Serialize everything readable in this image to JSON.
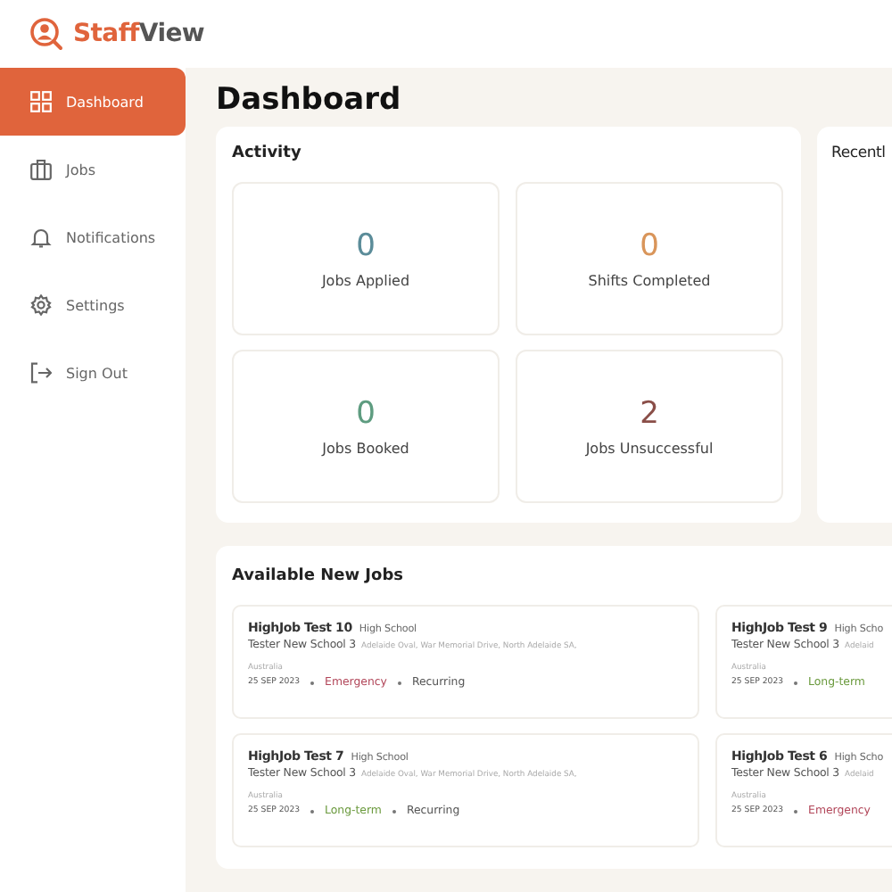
{
  "brand": {
    "name_part1": "Staff",
    "name_part2": "View"
  },
  "sidebar": {
    "items": [
      {
        "label": "Dashboard",
        "selected": true
      },
      {
        "label": "Jobs",
        "selected": false
      },
      {
        "label": "Notifications",
        "selected": false
      },
      {
        "label": "Settings",
        "selected": false
      },
      {
        "label": "Sign Out",
        "selected": false
      }
    ]
  },
  "page_title": "Dashboard",
  "activity": {
    "title": "Activity",
    "stats": [
      {
        "value": "0",
        "label": "Jobs Applied",
        "color": "#5b8c99"
      },
      {
        "value": "0",
        "label": "Shifts Completed",
        "color": "#d9955a"
      },
      {
        "value": "0",
        "label": "Jobs Booked",
        "color": "#5e9c80"
      },
      {
        "value": "2",
        "label": "Jobs Unsuccessful",
        "color": "#8a4e48"
      }
    ]
  },
  "recent": {
    "title": "Recentl"
  },
  "available_jobs": {
    "title": "Available New Jobs",
    "jobs": [
      {
        "title": "HighJob Test 10",
        "level": "High School",
        "school": "Tester New School 3",
        "address_lines": [
          "Adelaide Oval, War Memorial Drive, North Adelaide SA,",
          "Australia"
        ],
        "date": "25 SEP 2023",
        "tags": [
          {
            "label": "Emergency",
            "kind": "emergency"
          },
          {
            "label": "Recurring",
            "kind": "plain"
          }
        ]
      },
      {
        "title": "HighJob Test 9",
        "level": "High Scho",
        "school": "Tester New School 3",
        "address_lines": [
          "Adelaid",
          "Australia"
        ],
        "date": "25 SEP 2023",
        "tags": [
          {
            "label": "Long-term",
            "kind": "longterm"
          }
        ]
      },
      {
        "title": "HighJob Test 7",
        "level": "High School",
        "school": "Tester New School 3",
        "address_lines": [
          "Adelaide Oval, War Memorial Drive, North Adelaide SA,",
          "Australia"
        ],
        "date": "25 SEP 2023",
        "tags": [
          {
            "label": "Long-term",
            "kind": "longterm"
          },
          {
            "label": "Recurring",
            "kind": "plain"
          }
        ]
      },
      {
        "title": "HighJob Test 6",
        "level": "High Scho",
        "school": "Tester New School 3",
        "address_lines": [
          "Adelaid",
          "Australia"
        ],
        "date": "25 SEP 2023",
        "tags": [
          {
            "label": "Emergency",
            "kind": "emergency"
          }
        ]
      }
    ]
  }
}
